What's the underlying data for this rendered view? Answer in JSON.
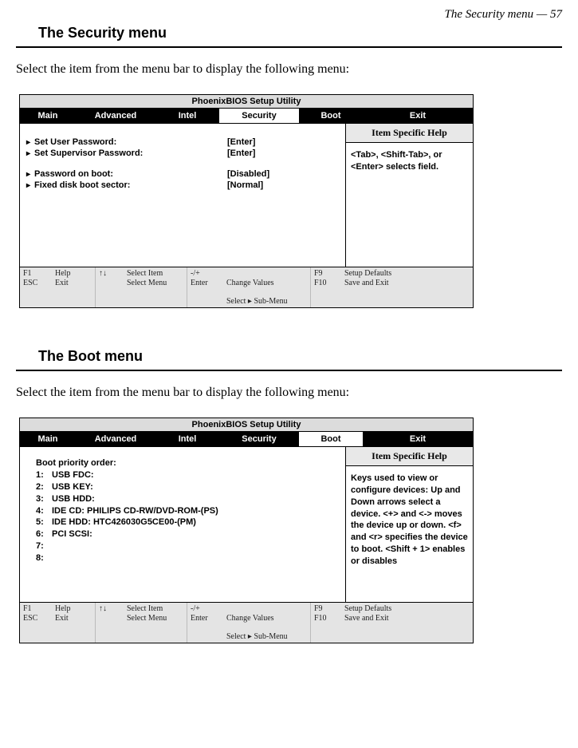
{
  "pageHeader": "The Security menu —  57",
  "section1": {
    "title": "The Security menu",
    "intro": "Select the item from the menu bar to display the following menu:"
  },
  "section2": {
    "title": "The Boot menu",
    "intro": "Select the item from the menu bar to display the following menu:"
  },
  "bios": {
    "title": "PhoenixBIOS Setup Utility",
    "tabs": {
      "main": "Main",
      "advanced": "Advanced",
      "intel": "Intel",
      "security": "Security",
      "boot": "Boot",
      "exit": "Exit"
    },
    "helpTitle": "Item Specific Help",
    "footer": {
      "c1": "F1\nESC",
      "c2": "Help\nExit",
      "c3": "↑↓",
      "c4": "Select Item\nSelect Menu",
      "c5": "-/+\nEnter",
      "c6a": "Change Values",
      "c6b": "Select ▸ Sub-Menu",
      "c7": "F9\nF10",
      "c8": "Setup Defaults\nSave and Exit"
    }
  },
  "security": {
    "fields": [
      {
        "label": "Set User Password:",
        "value": "[Enter]"
      },
      {
        "label": "Set Supervisor Password:",
        "value": "[Enter]"
      }
    ],
    "fields2": [
      {
        "label": "Password on boot:",
        "value": "[Disabled]"
      },
      {
        "label": "Fixed disk boot sector:",
        "value": "[Normal]"
      }
    ],
    "help": "<Tab>,  <Shift-Tab>,  or <Enter> selects field."
  },
  "boot": {
    "header": "Boot priority order:",
    "items": [
      {
        "n": "1:",
        "label": "USB FDC:"
      },
      {
        "n": "2:",
        "label": "USB KEY:"
      },
      {
        "n": "3:",
        "label": "USB HDD:"
      },
      {
        "n": "4:",
        "label": "IDE CD: PHILIPS CD-RW/DVD-ROM-(PS)"
      },
      {
        "n": "5:",
        "label": "IDE HDD: HTC426030G5CE00-(PM)"
      },
      {
        "n": "6:",
        "label": "PCI SCSI:"
      },
      {
        "n": "7:",
        "label": ""
      },
      {
        "n": "8:",
        "label": ""
      }
    ],
    "help": "Keys used to view or configure devices: Up and Down arrows select a device. <+> and <-> moves the device up or down. <f> and <r> specifies the device to boot. <Shift + 1> enables or disables"
  }
}
